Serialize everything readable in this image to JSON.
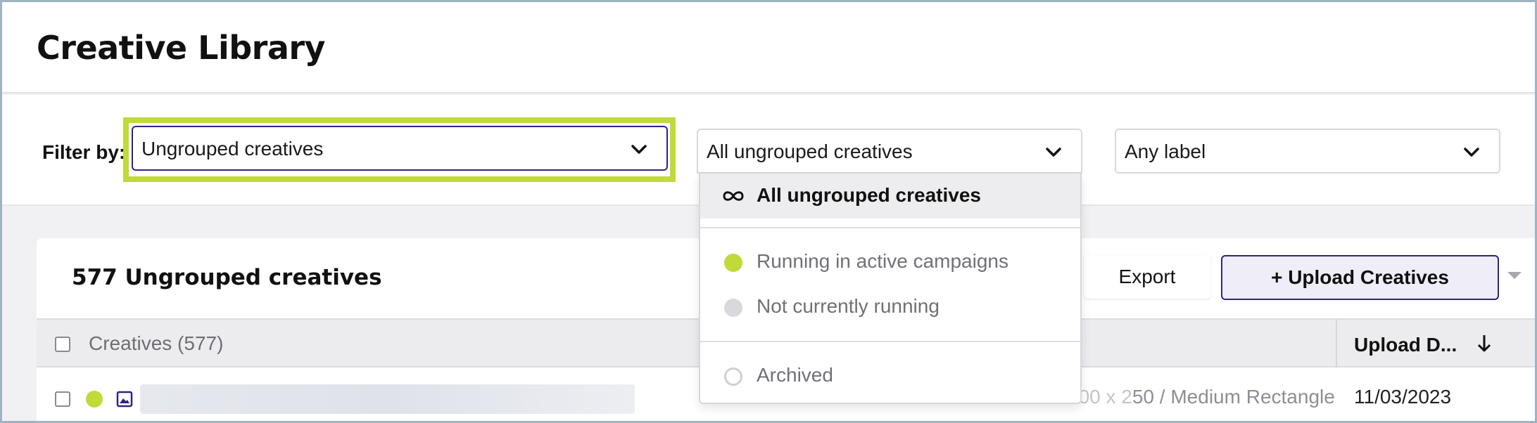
{
  "page": {
    "title": "Creative Library"
  },
  "filters": {
    "label": "Filter by:",
    "group_select": {
      "value": "Ungrouped creatives"
    },
    "status_select": {
      "value": "All ungrouped creatives"
    },
    "label_select": {
      "value": "Any label"
    }
  },
  "status_dropdown": {
    "items": [
      {
        "label": "All ungrouped creatives",
        "icon": "infinity-icon",
        "selected": true
      },
      {
        "label": "Running in active campaigns",
        "icon": "green-dot",
        "color": "#c2d93a"
      },
      {
        "label": "Not currently running",
        "icon": "gray-dot",
        "color": "#d9d9dd"
      },
      {
        "label": "Archived",
        "icon": "empty-circle"
      }
    ]
  },
  "list": {
    "title": "577 Ungrouped creatives",
    "export_label": "Export",
    "upload_label": "+ Upload Creatives",
    "columns": {
      "creatives": "Creatives (577)",
      "upload_date": "Upload D..."
    },
    "rows": [
      {
        "status_color": "#c2d93a",
        "size_prefix": "300 x 2",
        "size_visible": "50",
        "size_label": "/ Medium Rectangle",
        "upload_date": "11/03/2023"
      }
    ]
  },
  "colors": {
    "accent_lime": "#c2d93a",
    "brand_navy": "#2f2480"
  }
}
